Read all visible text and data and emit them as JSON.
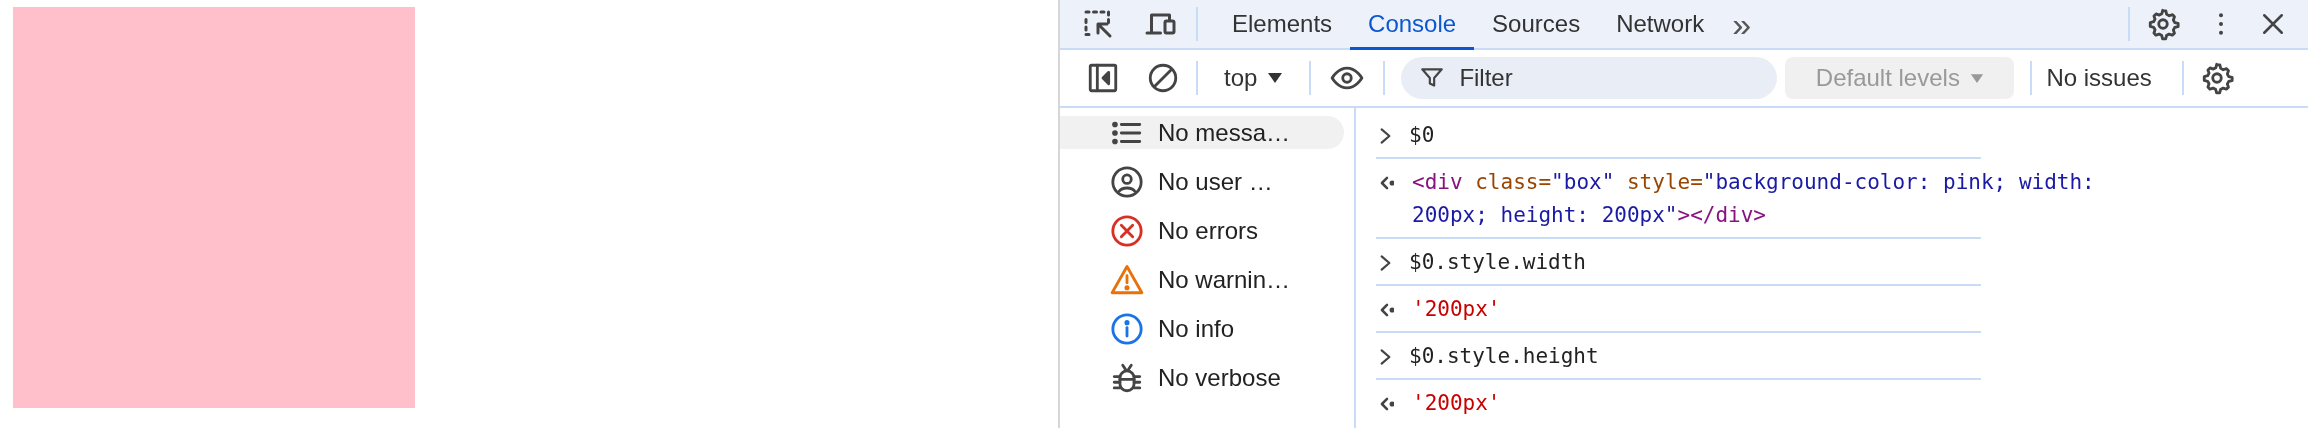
{
  "page": {
    "box": {
      "color": "#ffc0cb"
    }
  },
  "tabs": [
    {
      "label": "Elements",
      "selected": false
    },
    {
      "label": "Console",
      "selected": true
    },
    {
      "label": "Sources",
      "selected": false
    },
    {
      "label": "Network",
      "selected": false
    }
  ],
  "more_tabs": "»",
  "toolbar": {
    "context": "top",
    "filter": {
      "placeholder": "Filter"
    },
    "levels": {
      "label": "Default levels",
      "disabled": true
    },
    "issues": "No issues"
  },
  "sidebar": {
    "items": [
      {
        "kind": "messages",
        "label": "No messa…",
        "selected": true
      },
      {
        "kind": "user",
        "label": "No user …",
        "selected": false
      },
      {
        "kind": "errors",
        "label": "No errors",
        "selected": false
      },
      {
        "kind": "warnings",
        "label": "No warnin…",
        "selected": false
      },
      {
        "kind": "info",
        "label": "No info",
        "selected": false
      },
      {
        "kind": "verbose",
        "label": "No verbose",
        "selected": false
      }
    ]
  },
  "console": [
    {
      "kind": "input",
      "lines": [
        [
          {
            "kind": "plain",
            "text": "$0"
          }
        ]
      ]
    },
    {
      "kind": "output",
      "lines": [
        [
          {
            "kind": "tag",
            "text": "<div"
          },
          {
            "kind": "attr",
            "text": " class="
          },
          {
            "kind": "value",
            "text": "\"box\""
          },
          {
            "kind": "attr",
            "text": " style="
          },
          {
            "kind": "value",
            "text": "\"background-color: pink; width:"
          }
        ],
        [
          {
            "kind": "value",
            "text": "200px; height: 200px\""
          },
          {
            "kind": "tag",
            "text": "></div>"
          }
        ]
      ]
    },
    {
      "kind": "input",
      "lines": [
        [
          {
            "kind": "plain",
            "text": "$0.style.width"
          }
        ]
      ]
    },
    {
      "kind": "output",
      "lines": [
        [
          {
            "kind": "string",
            "text": "'200px'"
          }
        ]
      ]
    },
    {
      "kind": "input",
      "lines": [
        [
          {
            "kind": "plain",
            "text": "$0.style.height"
          }
        ]
      ]
    },
    {
      "kind": "output",
      "lines": [
        [
          {
            "kind": "string",
            "text": "'200px'"
          }
        ]
      ]
    }
  ]
}
